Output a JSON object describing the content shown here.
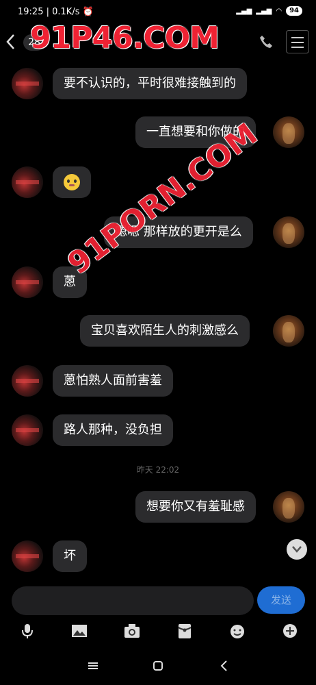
{
  "status": {
    "time": "19:25",
    "speed": "0.1K/s",
    "battery": "94"
  },
  "header": {
    "unread_count": "28"
  },
  "watermarks": [
    "91P46.COM",
    "91PORN.COM"
  ],
  "messages": [
    {
      "side": "left",
      "text": "要不认识的，平时很难接触到的"
    },
    {
      "side": "right",
      "text": "一直想要和你做的"
    },
    {
      "side": "left",
      "emoji": "drooling-face"
    },
    {
      "side": "right",
      "text": "嗯嗯 那样放的更开是么"
    },
    {
      "side": "left",
      "text": "蒽"
    },
    {
      "side": "right",
      "text": "宝贝喜欢陌生人的刺激感么"
    },
    {
      "side": "left",
      "text": "蒽怕熟人面前害羞"
    },
    {
      "side": "left",
      "text": "路人那种，没负担"
    },
    {
      "side": "right",
      "text": "想要你又有羞耻感"
    },
    {
      "side": "left",
      "text": "坏"
    }
  ],
  "timestamp": "昨天 22:02",
  "composer": {
    "send_label": "发送"
  },
  "toolbar_icons": [
    "mic-icon",
    "image-icon",
    "camera-icon",
    "red-packet-icon",
    "emoji-icon",
    "plus-icon"
  ],
  "navbar_icons": [
    "menu-icon",
    "home-icon",
    "back-icon"
  ],
  "colors": {
    "bubble": "#2b2b2d",
    "send": "#1f6dd3",
    "watermark": "#e22233"
  }
}
